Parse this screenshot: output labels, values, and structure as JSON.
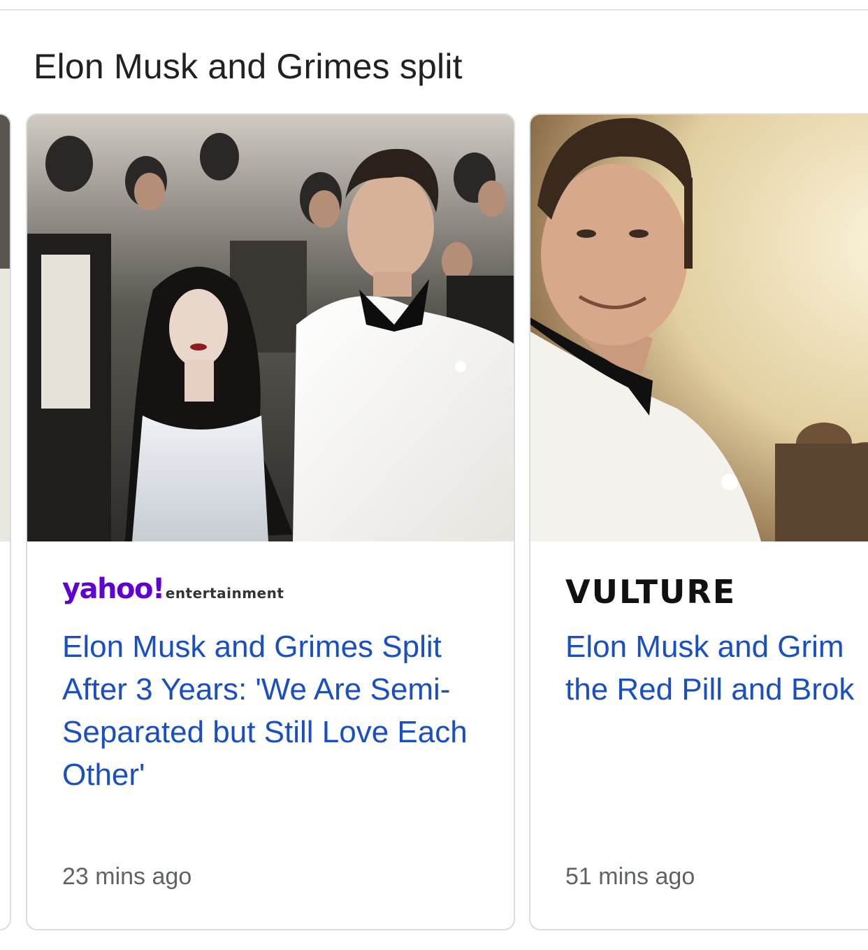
{
  "section": {
    "title": "Elon Musk and Grimes split"
  },
  "cards": [
    {
      "source": "yahoo!entertainment",
      "source_main": "yahoo!",
      "source_sub": "entertainment",
      "source_color": "#6001d2",
      "headline": "Elon Musk and Grimes Split After 3 Years: 'We Are Semi-Separated but Still Love Each Other'",
      "time": "23 mins ago"
    },
    {
      "source": "VULTURE",
      "headline_line1": "Elon Musk and Grim",
      "headline_line2": "the Red Pill and Brok",
      "time": "51 mins ago"
    }
  ],
  "colors": {
    "headline_link": "#1a4fc4",
    "meta_text": "#5f6368",
    "card_border": "#dadce0"
  }
}
